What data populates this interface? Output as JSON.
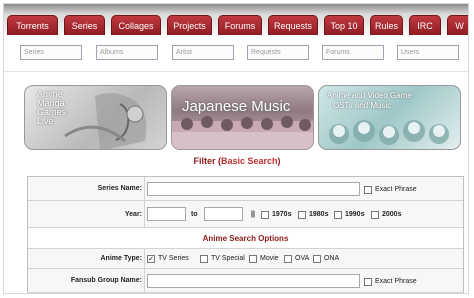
{
  "nav": {
    "tabs": [
      "Torrents",
      "Series",
      "Collages",
      "Projects",
      "Forums",
      "Requests",
      "Top 10",
      "Rules",
      "IRC",
      "W"
    ]
  },
  "search": {
    "series": "Series",
    "albums": "Albums",
    "artist": "Artist",
    "requests": "Requests",
    "forums": "Forums",
    "users": "Users"
  },
  "banners": {
    "anime_manga_lines": [
      "Anime",
      "Manga",
      "Games",
      "Live"
    ],
    "japanese_music": "Japanese Music",
    "ost_title": "Anime and Video Game",
    "ost_sub": "OSTs and Music"
  },
  "filter": {
    "title": "Filter",
    "basic_search": "Basic Search"
  },
  "form": {
    "series_name_label": "Series Name:",
    "exact_phrase": "Exact Phrase",
    "year_label": "Year:",
    "to": "to",
    "separator": "||",
    "decades": [
      "1970s",
      "1980s",
      "1990s",
      "2000s"
    ],
    "section_title": "Anime Search Options",
    "anime_type_label": "Anime Type:",
    "anime_types": [
      "TV Series",
      "TV Special",
      "Movie",
      "OVA",
      "ONA"
    ],
    "anime_types_checked": [
      true,
      false,
      false,
      false,
      false
    ],
    "fansub_label": "Fansub Group Name:",
    "exact_phrase_2": "Exact Phrase"
  }
}
